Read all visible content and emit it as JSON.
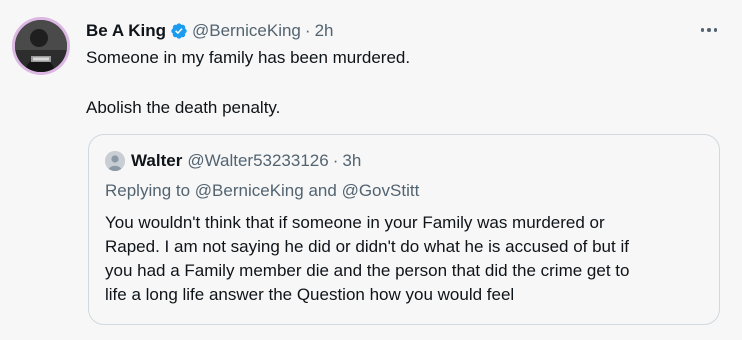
{
  "tweet": {
    "display_name": "Be A King",
    "handle": "@BerniceKing",
    "separator": "·",
    "time": "2h",
    "text_line_1": "Someone in my family has been murdered.",
    "text_line_2": "Abolish the death penalty.",
    "avatar_icon": "profile-photo",
    "verified_icon": "verified-badge-icon",
    "more_icon": "more-options-icon"
  },
  "quoted": {
    "display_name": "Walter",
    "handle": "@Walter53233126",
    "separator": "·",
    "time": "3h",
    "replying_prefix": "Replying to",
    "replying_user_1": "@BerniceKing",
    "replying_and": "and",
    "replying_user_2": "@GovStitt",
    "body_lines": [
      "You wouldn't think that if someone in your Family was murdered or",
      "Raped. I am not saying he did or didn't do what he is accused of but if",
      "you had a Family member die and the person that did the crime get to",
      "life a long life answer the Question how you would feel"
    ]
  },
  "colors": {
    "background": "#f7f7f7",
    "text_primary": "#0f1419",
    "text_secondary": "#536471",
    "verified_blue": "#1d9bf0",
    "border": "#cfd9de",
    "avatar_ring": "#dcb7e3"
  }
}
